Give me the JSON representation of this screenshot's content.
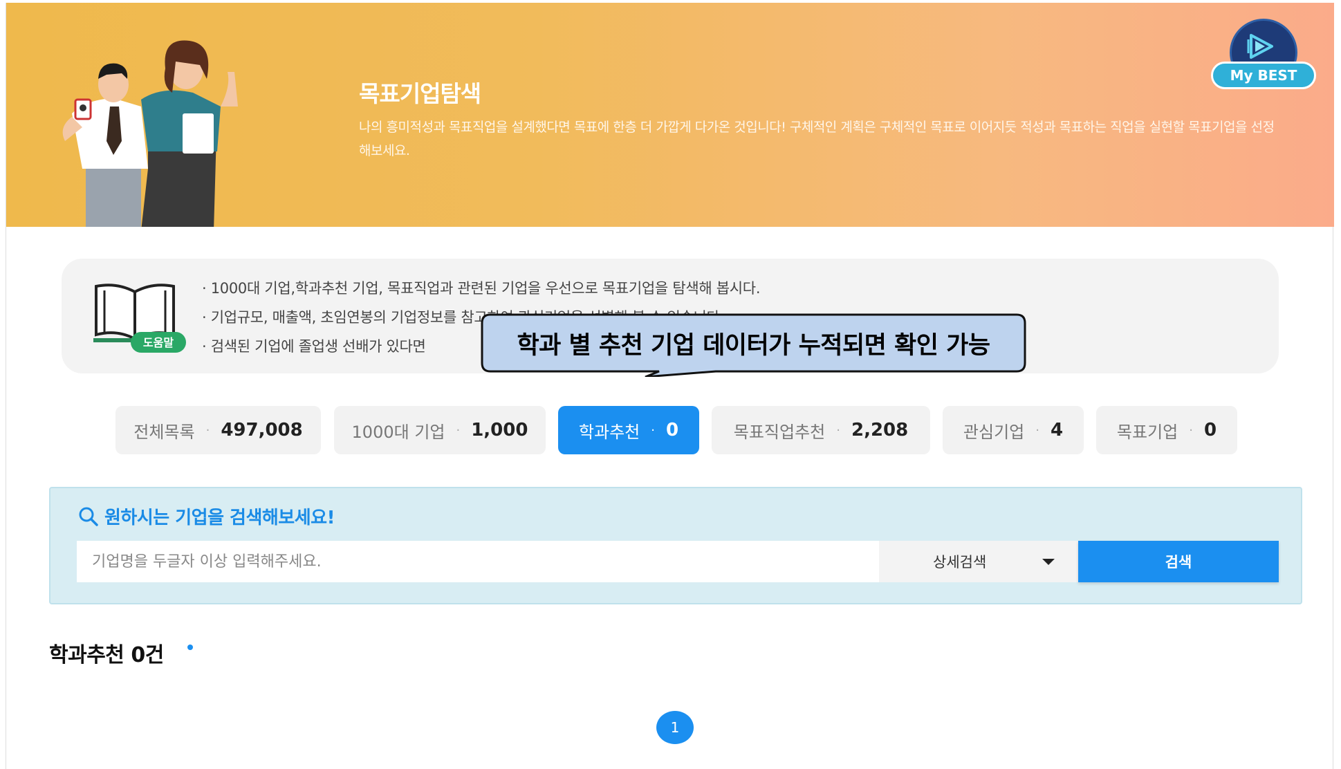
{
  "banner": {
    "title": "목표기업탐색",
    "description": "나의 흥미적성과 목표직업을 설계했다면 목표에 한층 더 가깝게 다가온 것입니다! 구체적인 계획은 구체적인 목표로 이어지듯 적성과 목표하는 직업을 실현할 목표기업을 선정해보세요.",
    "logo_text": "My BEST"
  },
  "help": {
    "badge": "도움말",
    "lines": [
      "· 1000대 기업,학과추천 기업, 목표직업과 관련된 기업을 우선으로 목표기업을 탐색해 봅시다.",
      "· 기업규모, 매출액, 초임연봉의 기업정보를 참고하여 관심기업을 선별해 볼 수 있습니다.",
      "· 검색된 기업에 졸업생 선배가 있다면"
    ]
  },
  "callout": {
    "text": "학과 별 추천 기업 데이터가 누적되면 확인 가능"
  },
  "tabs": [
    {
      "label": "전체목록",
      "count": "497,008",
      "active": false
    },
    {
      "label": "1000대 기업",
      "count": "1,000",
      "active": false
    },
    {
      "label": "학과추천",
      "count": "0",
      "active": true
    },
    {
      "label": "목표직업추천",
      "count": "2,208",
      "active": false
    },
    {
      "label": "관심기업",
      "count": "4",
      "active": false
    },
    {
      "label": "목표기업",
      "count": "0",
      "active": false
    }
  ],
  "tab_separator": "·",
  "search": {
    "heading": "원하시는 기업을 검색해보세요!",
    "placeholder": "기업명을 두글자 이상 입력해주세요.",
    "detail_label": "상세검색",
    "button_label": "검색"
  },
  "results": {
    "title": "학과추천 0건"
  },
  "pagination": {
    "current_page": "1"
  },
  "colors": {
    "accent": "#1b8ff0",
    "banner_start": "#efb94c",
    "banner_end": "#fbab8a",
    "search_bg": "#d8edf3"
  }
}
